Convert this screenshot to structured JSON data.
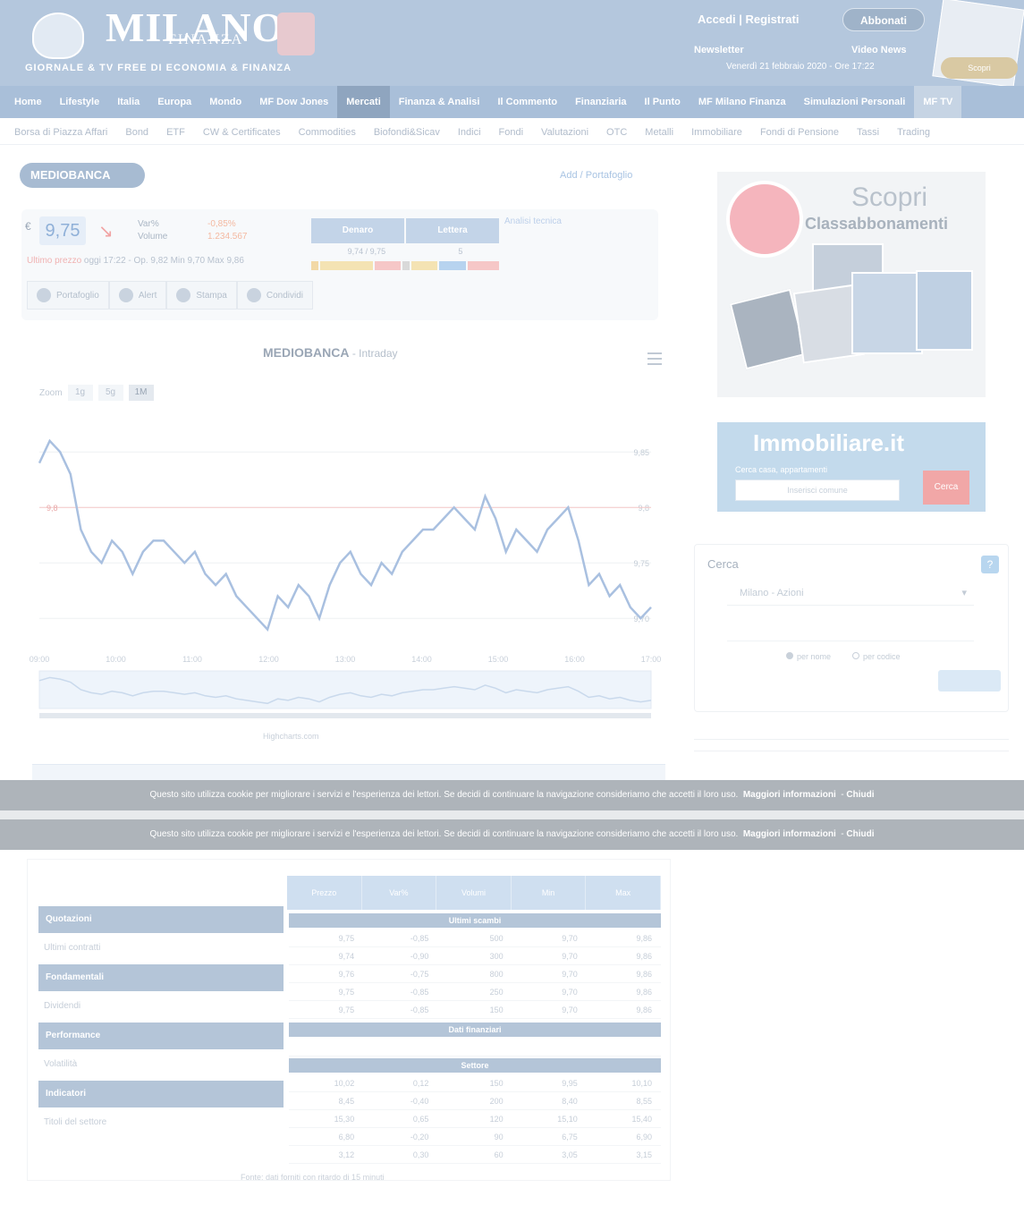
{
  "header": {
    "logo_line1": "MILANO",
    "logo_line2": "FINANZA",
    "tagline": "GIORNALE & TV FREE DI ECONOMIA & FINANZA",
    "login_label": "Accedi  |  Registrati",
    "subscribe_label": "Abbonati",
    "newsletter_label": "Newsletter",
    "videonews_label": "Video News",
    "datetime": "Venerdì 21 febbraio 2020 - Ore 17:22",
    "promo_label": "Scopri Classabbonamenti"
  },
  "nav": {
    "items": [
      "Home",
      "Lifestyle",
      "Italia",
      "Europa",
      "Mondo",
      "MF Dow Jones",
      "Mercati",
      "Finanza & Analisi",
      "Il Commento",
      "Finanziaria",
      "Il Punto",
      "MF Milano Finanza",
      "Simulazioni Personali",
      "MF TV"
    ],
    "active_index": 6
  },
  "subnav": {
    "items": [
      "Borsa di Piazza Affari",
      "Bond",
      "ETF",
      "CW & Certificates",
      "Commodities",
      "Biofondi&Sicav",
      "Indici",
      "Fondi",
      "Valutazioni",
      "OTC",
      "Metalli",
      "Immobiliare",
      "Fondi di Pensione",
      "Tassi",
      "Trading"
    ]
  },
  "stock": {
    "name": "MEDIOBANCA",
    "add_portfolio": "Add / Portafoglio",
    "currency": "€",
    "price": "9,75",
    "change_label_1": "Var%",
    "change_label_2": "Volume",
    "change_abs_1": "-0,85%",
    "change_abs_2": "1.234.567",
    "timestamp_prefix": "Ultimo prezzo",
    "timestamp_rest": "oggi 17:22 - Op. 9,82 Min 9,70 Max 9,86",
    "book_tabs": [
      "Denaro",
      "Lettera"
    ],
    "book_row": [
      "9,74 / 9,75",
      "5"
    ],
    "chart_link": "Analisi tecnica",
    "actions": [
      "Portafoglio",
      "Alert",
      "Stampa",
      "Condividi"
    ]
  },
  "chart": {
    "title_main": "MEDIOBANCA",
    "title_sub": "Intraday",
    "zoom_label": "Zoom",
    "zoom_buttons": [
      "1g",
      "5g",
      "1M"
    ],
    "zoom_selected": 2,
    "credits": "Highcharts.com",
    "reference_label": "9,8"
  },
  "chart_data": {
    "type": "line",
    "title": "MEDIOBANCA",
    "x": [
      "09:00",
      "10:00",
      "11:00",
      "12:00",
      "13:00",
      "14:00",
      "15:00",
      "16:00",
      "17:00"
    ],
    "y_ticks": [
      "9,85",
      "9,8",
      "9,75",
      "9,70"
    ],
    "ylim": [
      9.68,
      9.88
    ],
    "series": [
      {
        "values": [
          9.84,
          9.86,
          9.85,
          9.83,
          9.78,
          9.76,
          9.75,
          9.77,
          9.76,
          9.74,
          9.76,
          9.77,
          9.77,
          9.76,
          9.75,
          9.76,
          9.74,
          9.73,
          9.74,
          9.72,
          9.71,
          9.7,
          9.69,
          9.72,
          9.71,
          9.73,
          9.72,
          9.7,
          9.73,
          9.75,
          9.76,
          9.74,
          9.73,
          9.75,
          9.74,
          9.76,
          9.77,
          9.78,
          9.78,
          9.79,
          9.8,
          9.79,
          9.78,
          9.81,
          9.79,
          9.76,
          9.78,
          9.77,
          9.76,
          9.78,
          9.79,
          9.8,
          9.77,
          9.73,
          9.74,
          9.72,
          9.73,
          9.71,
          9.7,
          9.71
        ]
      }
    ],
    "reference_line": 9.8
  },
  "right": {
    "ad_top_title": "Scopri",
    "ad_top_subtitle": "Classabbonamenti",
    "immo_logo": "Immobiliare.it",
    "immo_sub": "Cerca casa, appartamenti",
    "immo_placeholder": "Inserisci comune",
    "immo_button": "Cerca",
    "cerca_title": "Cerca",
    "cerca_help": "?",
    "cerca_select": "Milano - Azioni",
    "cerca_radio": [
      "per nome",
      "per codice"
    ]
  },
  "cookie": {
    "text": "Questo sito utilizza cookie per migliorare i servizi e l'esperienza dei lettori. Se decidi di continuare la navigazione consideriamo che accetti il loro uso.",
    "link": "Maggiori informazioni",
    "close": "Chiudi"
  },
  "table": {
    "headers": [
      "Prezzo",
      "Var%",
      "Volumi",
      "Min",
      "Max"
    ],
    "categories": [
      {
        "label": "Quotazioni",
        "sub": "Ultimi contratti"
      },
      {
        "label": "Fondamentali",
        "sub": "Dividendi"
      },
      {
        "label": "Performance",
        "sub": "Volatilità"
      },
      {
        "label": "Indicatori",
        "sub": "Titoli del settore"
      }
    ],
    "sections": [
      "Ultimi scambi",
      "Dati finanziari",
      "Settore"
    ],
    "rows_1": [
      [
        "9,75",
        "-0,85",
        "500",
        "9,70",
        "9,86"
      ],
      [
        "9,74",
        "-0,90",
        "300",
        "9,70",
        "9,86"
      ],
      [
        "9,76",
        "-0,75",
        "800",
        "9,70",
        "9,86"
      ],
      [
        "9,75",
        "-0,85",
        "250",
        "9,70",
        "9,86"
      ],
      [
        "9,75",
        "-0,85",
        "150",
        "9,70",
        "9,86"
      ]
    ],
    "rows_2": [
      [
        "10,02",
        "0,12",
        "150",
        "9,95",
        "10,10"
      ],
      [
        "8,45",
        "-0,40",
        "200",
        "8,40",
        "8,55"
      ],
      [
        "15,30",
        "0,65",
        "120",
        "15,10",
        "15,40"
      ],
      [
        "6,80",
        "-0,20",
        "90",
        "6,75",
        "6,90"
      ],
      [
        "3,12",
        "0,30",
        "60",
        "3,05",
        "3,15"
      ]
    ],
    "note": "Fonte: dati forniti con ritardo di 15 minuti"
  }
}
